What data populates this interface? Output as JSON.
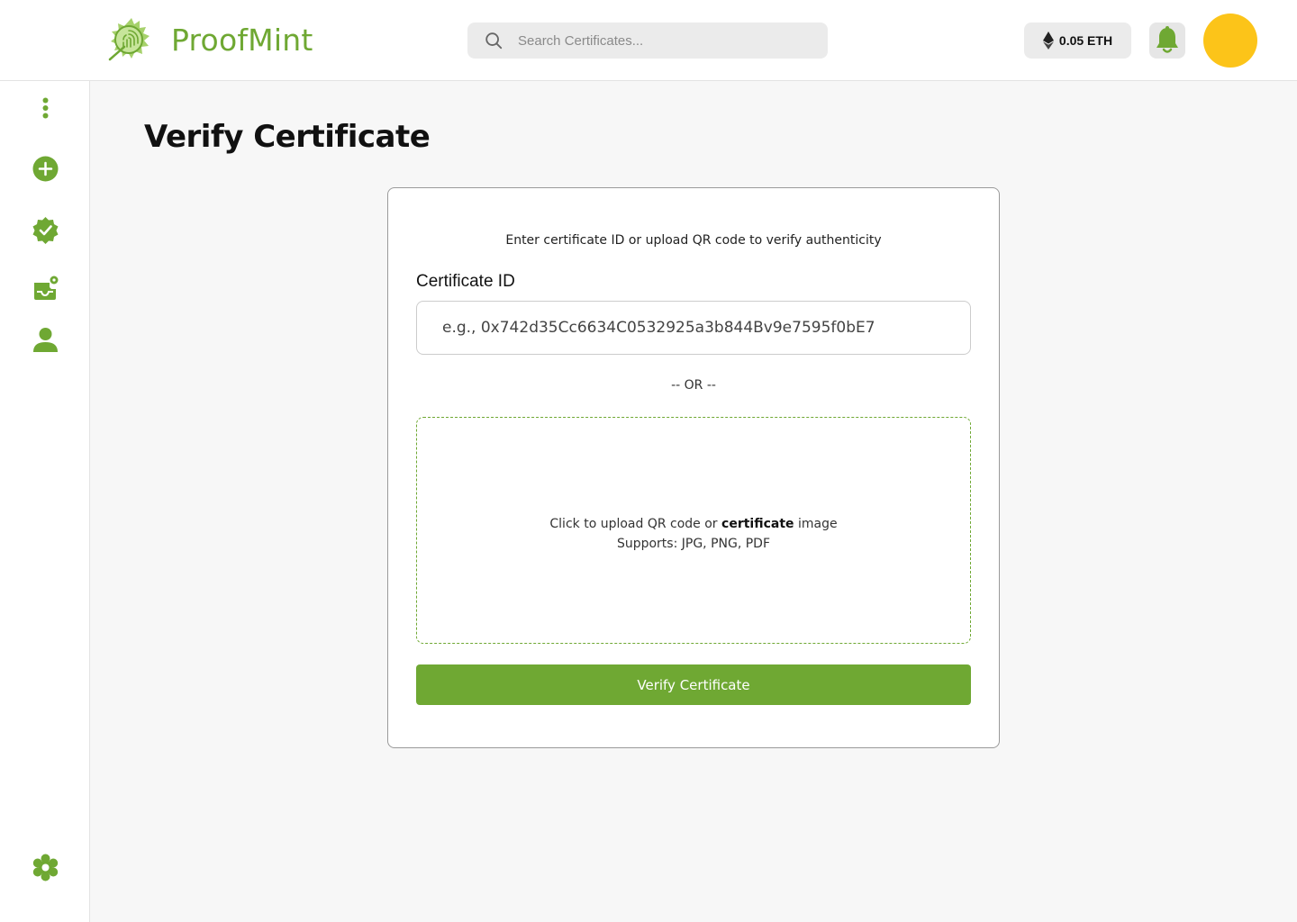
{
  "brand": {
    "name": "ProofMint",
    "accent": "#6fa833"
  },
  "header": {
    "search_placeholder": "Search Certificates...",
    "wallet_balance": "0.05 ETH",
    "avatar_color": "#fcc419"
  },
  "sidebar": {
    "items": [
      {
        "icon": "more-vertical-icon"
      },
      {
        "icon": "add-circle-icon"
      },
      {
        "icon": "verified-badge-icon"
      },
      {
        "icon": "inbox-settings-icon"
      },
      {
        "icon": "user-icon"
      },
      {
        "icon": "settings-gear-icon"
      }
    ]
  },
  "main": {
    "title": "Verify Certificate",
    "card": {
      "subtitle": "Enter certificate ID or upload QR code to verify authenticity",
      "id_label": "Certificate ID",
      "id_placeholder": "e.g., 0x742d35Cc6634C0532925a3b844Bv9e7595f0bE7",
      "or_text": "-- OR --",
      "upload_line1_prefix": "Click to upload QR code or ",
      "upload_line1_bold": "certificate",
      "upload_line1_suffix": " image",
      "upload_line2": "Supports: JPG, PNG, PDF",
      "button_label": "Verify Certificate"
    }
  }
}
